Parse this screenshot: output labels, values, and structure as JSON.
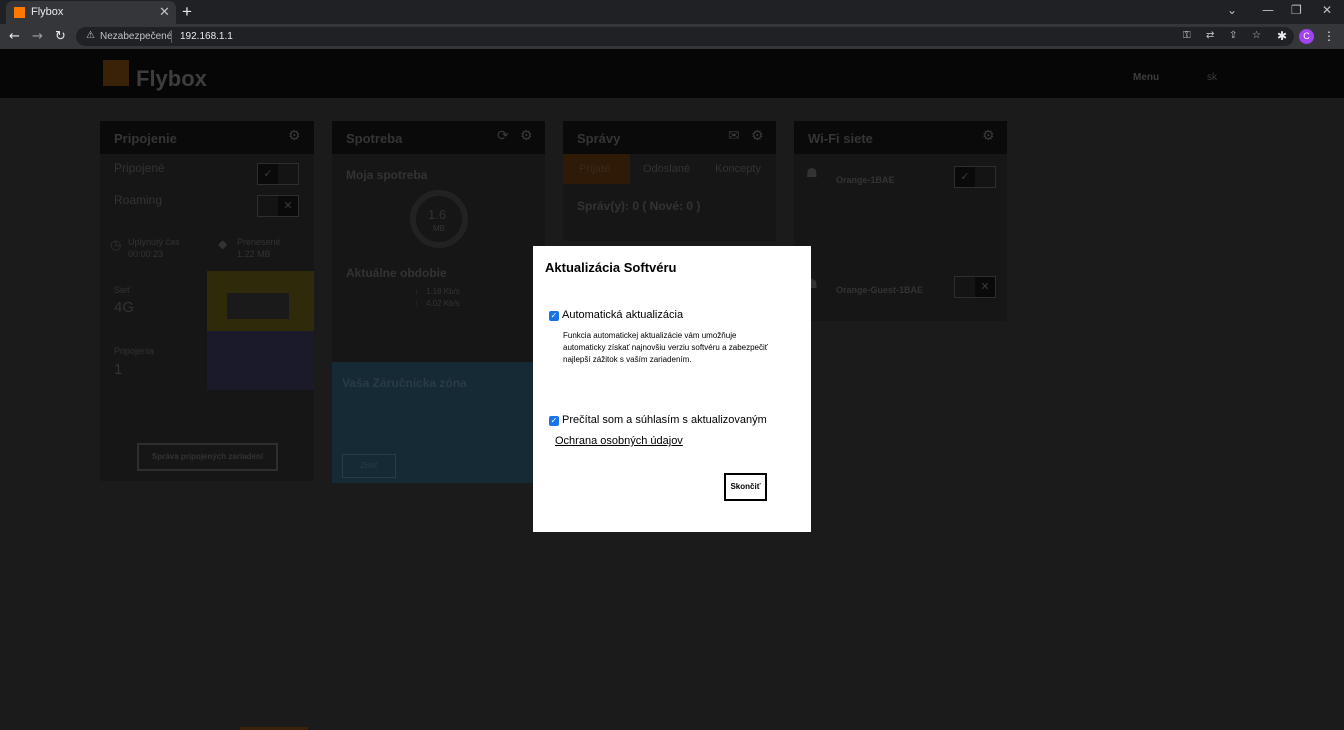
{
  "browser": {
    "tab_title": "Flybox",
    "new_tab": "+",
    "insecure_label": "Nezabezpečené",
    "url": "192.168.1.1",
    "profile_initial": "C"
  },
  "site": {
    "brand": "Flybox",
    "menu": "Menu",
    "language": "sk"
  },
  "cards": {
    "connection": {
      "title": "Pripojenie",
      "connected_label": "Pripojené",
      "roaming_label": "Roaming",
      "time_label": "Uplynutý čas",
      "time_value": "00:00:23",
      "transfer_label": "Prenesené",
      "transfer_value": "1.22 MB",
      "network_label": "Sieť",
      "network_value": "4G",
      "devices_label": "Pripojenia",
      "devices_value": "1",
      "devices_button": "Správa pripojených zariadení"
    },
    "usage": {
      "title": "Spotreba",
      "my_usage": "Moja spotreba",
      "gauge_value": "1.6",
      "gauge_unit": "MB",
      "period": "Aktuálne obdobie",
      "down_speed": "1.18 Kb/s",
      "up_speed": "4.02 Kb/s",
      "promo_title": "Vaša Záručnícka zóna",
      "promo_button": "Zistiť"
    },
    "messages": {
      "title": "Správy",
      "tabs": [
        "Prijaté",
        "Odoslané",
        "Koncepty"
      ],
      "count_text": "Správ(y): 0 ( Nové: 0 )"
    },
    "wifi": {
      "title": "Wi-Fi siete",
      "network1": "Orange-1BAE",
      "network2": "Orange-Guest-1BAE"
    }
  },
  "modal": {
    "title": "Aktualizácia Softvéru",
    "auto_update_label": "Automatická aktualizácia",
    "auto_update_checked": true,
    "auto_update_desc": "Funkcia automatickej aktualizácie vám umožňuje automaticky získať najnovšiu verziu softvéru a zabezpečiť najlepší zážitok s vaším zariadením.",
    "agree_label": "Prečítal som a súhlasím s aktualizovaným",
    "agree_checked": true,
    "privacy_link": "Ochrana osobných údajov",
    "finish_button": "Skončiť"
  },
  "colors": {
    "brand_orange": "#ff7900",
    "checkbox_blue": "#1a73e8",
    "overlay": "#1b1b1b"
  }
}
